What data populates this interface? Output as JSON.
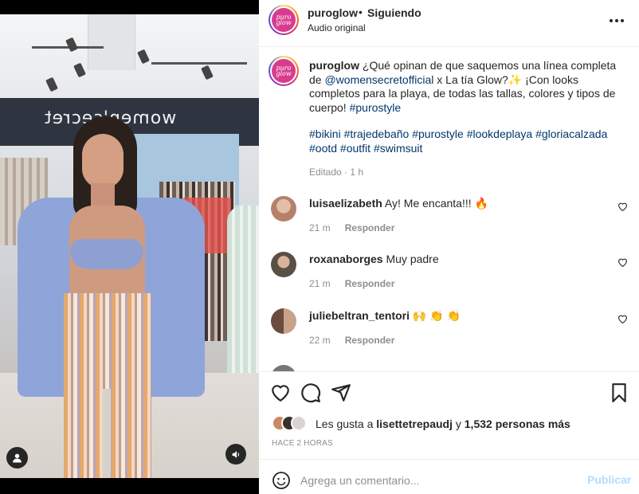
{
  "header": {
    "logo_text_1": "puro",
    "logo_text_2": "glow",
    "username": "puroglow",
    "dot": "•",
    "follow_state": "Siguiendo",
    "audio": "Audio original"
  },
  "caption": {
    "username": "puroglow",
    "text_1": " ¿Qué opinan de que saquemos una línea completa de ",
    "mention": "@womensecretofficial",
    "text_2": " x La tía Glow?✨ ¡Con looks completos para la playa, de todas las tallas, colores y tipos de cuerpo! ",
    "hashtag_1": "#purostyle",
    "hashtags": "#bikini #trajedebaño #purostyle #lookdeplaya #gloriacalzada #ootd #outfit #swimsuit",
    "edited": "Editado · 1 h"
  },
  "comments": [
    {
      "user": "luisaelizabeth",
      "text": " Ay! Me encanta!!! 🔥",
      "time": "21 m",
      "reply": "Responder",
      "avatar_color": "#b7806b"
    },
    {
      "user": "roxanaborges",
      "text": " Muy padre",
      "time": "21 m",
      "reply": "Responder",
      "avatar_color": "#5a4f45"
    },
    {
      "user": "juliebeltran_tentori",
      "text": " 🙌 👏 👏",
      "time": "22 m",
      "reply": "Responder",
      "avatar_color": "#6b4b3d"
    }
  ],
  "likes": {
    "prefix": "Les gusta a ",
    "user": "lisettetrepaudj",
    "joiner": " y ",
    "count": "1,532 personas más"
  },
  "time_ago": "HACE 2 HORAS",
  "add_comment": {
    "placeholder": "Agrega un comentario...",
    "publish": "Publicar"
  },
  "store_sign": "women'secret",
  "colors": {
    "link": "#00376b",
    "muted": "#8e8e8e",
    "publish_disabled": "#b3dbff",
    "brand_pink": "#d93c8f"
  }
}
